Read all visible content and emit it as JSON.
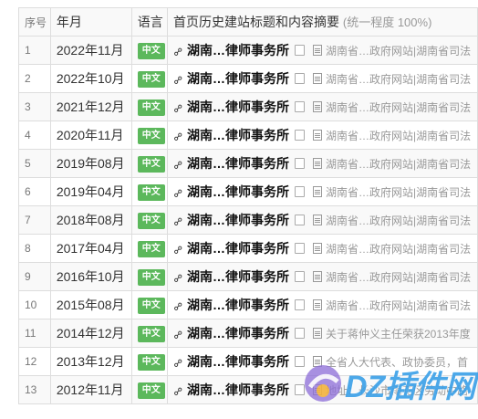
{
  "header": {
    "col_index": "序号",
    "col_month": "年月",
    "col_lang": "语言",
    "col_summary": "首页历史建站标题和内容摘要",
    "col_summary_sub": "(统一程度 100%)"
  },
  "rows": [
    {
      "idx": "1",
      "month": "2022年11月",
      "lang": "中文",
      "title": "湖南…律师事务所",
      "desc": "湖南省…政府网站|湖南省司法"
    },
    {
      "idx": "2",
      "month": "2022年10月",
      "lang": "中文",
      "title": "湖南…律师事务所",
      "desc": "湖南省…政府网站|湖南省司法"
    },
    {
      "idx": "3",
      "month": "2021年12月",
      "lang": "中文",
      "title": "湖南…律师事务所",
      "desc": "湖南省…政府网站|湖南省司法"
    },
    {
      "idx": "4",
      "month": "2020年11月",
      "lang": "中文",
      "title": "湖南…律师事务所",
      "desc": "湖南省…政府网站|湖南省司法"
    },
    {
      "idx": "5",
      "month": "2019年08月",
      "lang": "中文",
      "title": "湖南…律师事务所",
      "desc": "湖南省…政府网站|湖南省司法"
    },
    {
      "idx": "6",
      "month": "2019年04月",
      "lang": "中文",
      "title": "湖南…律师事务所",
      "desc": "湖南省…政府网站|湖南省司法"
    },
    {
      "idx": "7",
      "month": "2018年08月",
      "lang": "中文",
      "title": "湖南…律师事务所",
      "desc": "湖南省…政府网站|湖南省司法"
    },
    {
      "idx": "8",
      "month": "2017年04月",
      "lang": "中文",
      "title": "湖南…律师事务所",
      "desc": "湖南省…政府网站|湖南省司法"
    },
    {
      "idx": "9",
      "month": "2016年10月",
      "lang": "中文",
      "title": "湖南…律师事务所",
      "desc": "湖南省…政府网站|湖南省司法"
    },
    {
      "idx": "10",
      "month": "2015年08月",
      "lang": "中文",
      "title": "湖南…律师事务所",
      "desc": "湖南省…政府网站|湖南省司法"
    },
    {
      "idx": "11",
      "month": "2014年12月",
      "lang": "中文",
      "title": "湖南…律师事务所",
      "desc": "关于蒋仲义主任荣获2013年度"
    },
    {
      "idx": "12",
      "month": "2013年12月",
      "lang": "中文",
      "title": "湖南…律师事务所",
      "desc": "全省人大代表、政协委员，首"
    },
    {
      "idx": "13",
      "month": "2012年11月",
      "lang": "中文",
      "title": "湖南…律师事务所",
      "desc": "地址：长沙市雨花区劳动中路"
    }
  ],
  "watermark": {
    "text": "DZ插件网"
  },
  "colors": {
    "badge": "#5cb85c",
    "border": "#dddddd",
    "stripe": "#f9f9f9"
  }
}
